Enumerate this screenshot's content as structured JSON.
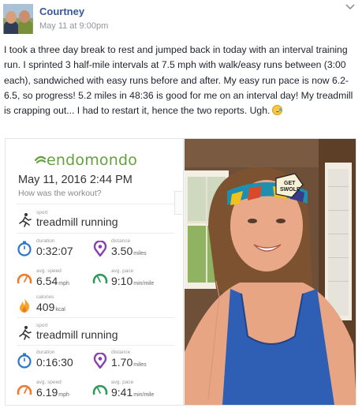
{
  "post": {
    "author": "Courtney",
    "timestamp": "May 11 at 9:00pm",
    "text": "I took a three day break to rest and jumped back in today with an interval training run. I sprinted 3 half-mile intervals at 7.5 mph with walk/easy runs between (3:00 each), sandwiched with easy runs before and after. My easy run pace is now 6.2-6.5, so progress! 5.2 miles in 48:36 is good for me on an interval day! My treadmill is crapping out... I had to restart it, hence the two reports. Ugh."
  },
  "workout": {
    "brand": "endomondo",
    "date": "May 11, 2016 2:44 PM",
    "question": "How was the workout?",
    "sessions": [
      {
        "sport_label": "sport",
        "sport": "treadmill running",
        "duration_label": "duration",
        "duration": "0:32:07",
        "distance_label": "distance",
        "distance": "3.50",
        "distance_unit": "miles",
        "speed_label": "avg. speed",
        "speed": "6.54",
        "speed_unit": "mph",
        "pace_label": "avg. pace",
        "pace": "9:10",
        "pace_unit": "min/mile",
        "calories_label": "calories",
        "calories": "409",
        "calories_unit": "kcal"
      },
      {
        "sport_label": "sport",
        "sport": "treadmill running",
        "duration_label": "duration",
        "duration": "0:16:30",
        "distance_label": "distance",
        "distance": "1.70",
        "distance_unit": "miles",
        "speed_label": "avg. speed",
        "speed": "6.19",
        "speed_unit": "mph",
        "pace_label": "avg. pace",
        "pace": "9:41",
        "pace_unit": "min/mile"
      }
    ]
  },
  "photo": {
    "headband_text_1": "GET",
    "headband_text_2": "SWOLE"
  },
  "colors": {
    "link": "#365899",
    "brand_green": "#63a23a",
    "duration_blue": "#2e77c6",
    "distance_purple": "#8a3fb0",
    "speed_orange": "#f07a2a",
    "pace_green": "#2f9a5a",
    "calories_orange": "#f5a623"
  },
  "icons": [
    "options-chevron-icon",
    "runner-icon",
    "stopwatch-icon",
    "map-pin-icon",
    "speedometer-icon",
    "pace-gauge-icon",
    "flame-icon",
    "tired-face-emoji"
  ]
}
